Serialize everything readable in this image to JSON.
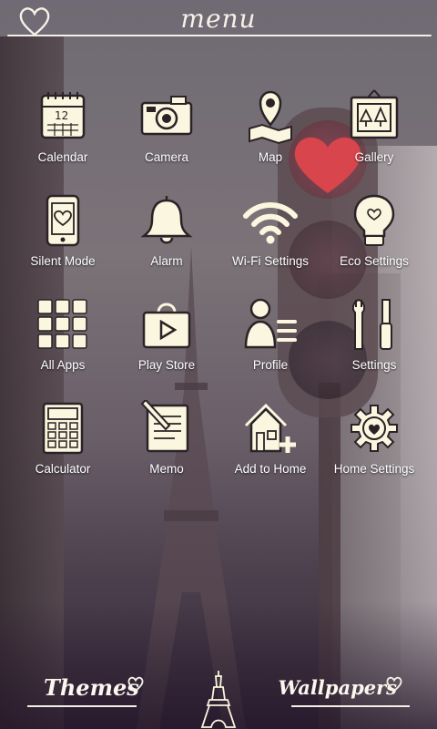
{
  "header": {
    "title": "menu",
    "heart_icon": "heart-outline-icon"
  },
  "apps": [
    {
      "label": "Calendar",
      "icon": "calendar-icon"
    },
    {
      "label": "Camera",
      "icon": "camera-icon"
    },
    {
      "label": "Map",
      "icon": "map-pin-icon"
    },
    {
      "label": "Gallery",
      "icon": "gallery-icon"
    },
    {
      "label": "Silent Mode",
      "icon": "phone-heart-icon"
    },
    {
      "label": "Alarm",
      "icon": "bell-icon"
    },
    {
      "label": "Wi-Fi Settings",
      "icon": "wifi-icon"
    },
    {
      "label": "Eco Settings",
      "icon": "lightbulb-icon"
    },
    {
      "label": "All Apps",
      "icon": "grid-icon"
    },
    {
      "label": "Play Store",
      "icon": "shopping-bag-play-icon"
    },
    {
      "label": "Profile",
      "icon": "person-icon"
    },
    {
      "label": "Settings",
      "icon": "tools-icon"
    },
    {
      "label": "Calculator",
      "icon": "calculator-icon"
    },
    {
      "label": "Memo",
      "icon": "memo-icon"
    },
    {
      "label": "Add to Home",
      "icon": "house-plus-icon"
    },
    {
      "label": "Home Settings",
      "icon": "gear-icon"
    }
  ],
  "calendar_day": "12",
  "footer": {
    "themes_label": "Themes",
    "wallpapers_label": "Wallpapers",
    "center_icon": "eiffel-tower-icon"
  },
  "colors": {
    "icon_fill": "#fbf6df",
    "icon_stroke": "#2a2326",
    "text": "#ffffff",
    "heart_red": "#d9454c"
  }
}
